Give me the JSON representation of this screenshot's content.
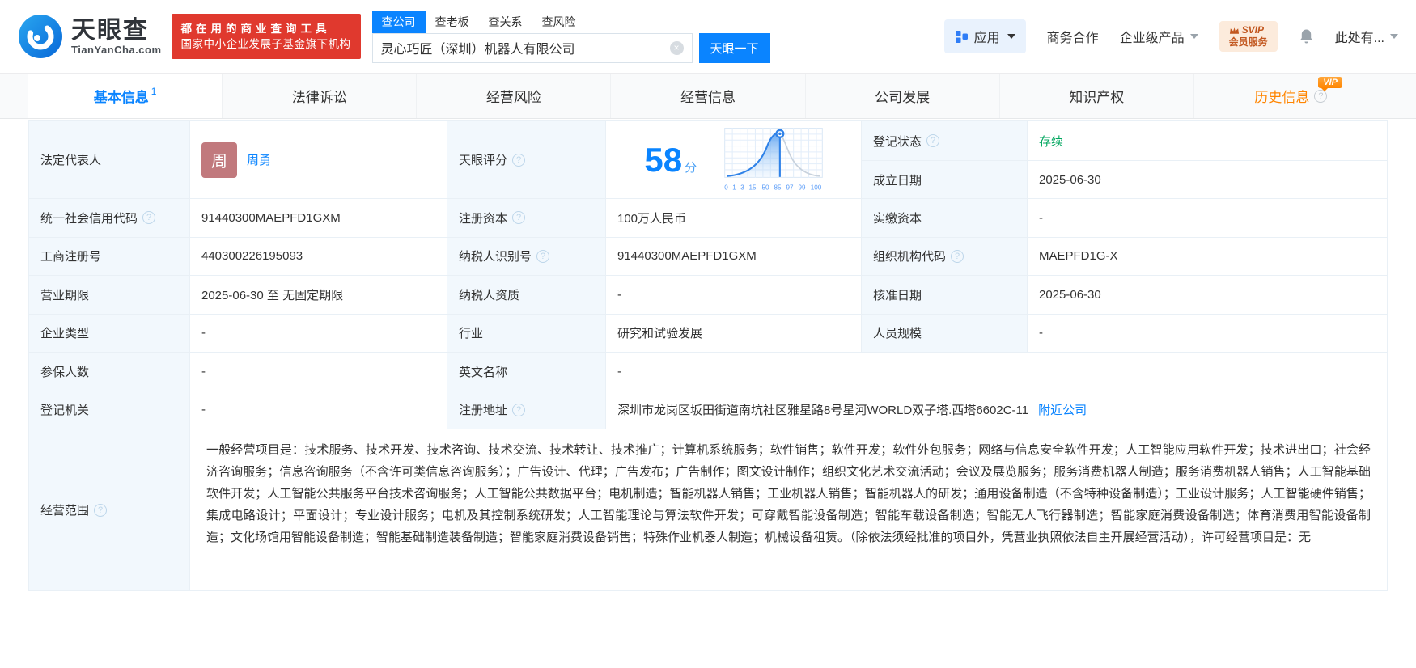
{
  "brand": {
    "name": "天眼查",
    "domain": "TianYanCha.com",
    "slogan1": "都在用的商业查询工具",
    "slogan2": "国家中小企业发展子基金旗下机构"
  },
  "search": {
    "tabs": [
      "查公司",
      "查老板",
      "查关系",
      "查风险"
    ],
    "value": "灵心巧匠（深圳）机器人有限公司",
    "button": "天眼一下"
  },
  "topnav": {
    "apps": "应用",
    "biz": "商务合作",
    "enterprise": "企业级产品",
    "svip_line1": "SVIP",
    "svip_line2": "会员服务",
    "user": "此处有..."
  },
  "tabs": [
    {
      "label": "基本信息",
      "count": "1"
    },
    {
      "label": "法律诉讼"
    },
    {
      "label": "经营风险"
    },
    {
      "label": "经营信息"
    },
    {
      "label": "公司发展"
    },
    {
      "label": "知识产权"
    },
    {
      "label": "历史信息",
      "vip": "VIP"
    }
  ],
  "fields": {
    "legal_rep": {
      "label": "法定代表人",
      "avatar": "周",
      "name": "周勇"
    },
    "reg_status": {
      "label": "登记状态",
      "value": "存续"
    },
    "est_date": {
      "label": "成立日期",
      "value": "2025-06-30"
    },
    "score": {
      "label": "天眼评分",
      "value": "58",
      "unit": "分"
    },
    "score_axis": [
      "0",
      "1",
      "3",
      "15",
      "50",
      "85",
      "97",
      "99",
      "100"
    ],
    "credit_code": {
      "label": "统一社会信用代码",
      "value": "91440300MAEPFD1GXM"
    },
    "reg_capital": {
      "label": "注册资本",
      "value": "100万人民币"
    },
    "paid_capital": {
      "label": "实缴资本",
      "value": "-"
    },
    "reg_number": {
      "label": "工商注册号",
      "value": "440300226195093"
    },
    "taxpayer_id": {
      "label": "纳税人识别号",
      "value": "91440300MAEPFD1GXM"
    },
    "org_code": {
      "label": "组织机构代码",
      "value": "MAEPFD1G-X"
    },
    "biz_term": {
      "label": "营业期限",
      "value": "2025-06-30 至 无固定期限"
    },
    "taxpayer_quality": {
      "label": "纳税人资质",
      "value": "-"
    },
    "approval_date": {
      "label": "核准日期",
      "value": "2025-06-30"
    },
    "company_type": {
      "label": "企业类型",
      "value": "-"
    },
    "industry": {
      "label": "行业",
      "value": "研究和试验发展"
    },
    "staff_size": {
      "label": "人员规模",
      "value": "-"
    },
    "insured_count": {
      "label": "参保人数",
      "value": "-"
    },
    "english_name": {
      "label": "英文名称",
      "value": "-"
    },
    "reg_authority": {
      "label": "登记机关",
      "value": "-"
    },
    "reg_address": {
      "label": "注册地址",
      "value": "深圳市龙岗区坂田街道南坑社区雅星路8号星河WORLD双子塔.西塔6602C-11",
      "link": "附近公司"
    },
    "business_scope": {
      "label": "经营范围",
      "value": "一般经营项目是：技术服务、技术开发、技术咨询、技术交流、技术转让、技术推广；计算机系统服务；软件销售；软件开发；软件外包服务；网络与信息安全软件开发；人工智能应用软件开发；技术进出口；社会经济咨询服务；信息咨询服务（不含许可类信息咨询服务）；广告设计、代理；广告发布；广告制作；图文设计制作；组织文化艺术交流活动；会议及展览服务；服务消费机器人制造；服务消费机器人销售；人工智能基础软件开发；人工智能公共服务平台技术咨询服务；人工智能公共数据平台；电机制造；智能机器人销售；工业机器人销售；智能机器人的研发；通用设备制造（不含特种设备制造）；工业设计服务；人工智能硬件销售；集成电路设计；平面设计；专业设计服务；电机及其控制系统研发；人工智能理论与算法软件开发；可穿戴智能设备制造；智能车载设备制造；智能无人飞行器制造；智能家庭消费设备制造；体育消费用智能设备制造；文化场馆用智能设备制造；智能基础制造装备制造；智能家庭消费设备销售；特殊作业机器人制造；机械设备租赁。（除依法须经批准的项目外，凭营业执照依法自主开展经营活动），许可经营项目是：无"
    }
  },
  "colors": {
    "accent": "#0a84ff",
    "green": "#00a65e",
    "orange": "#ff8500",
    "red": "#e0392e"
  }
}
